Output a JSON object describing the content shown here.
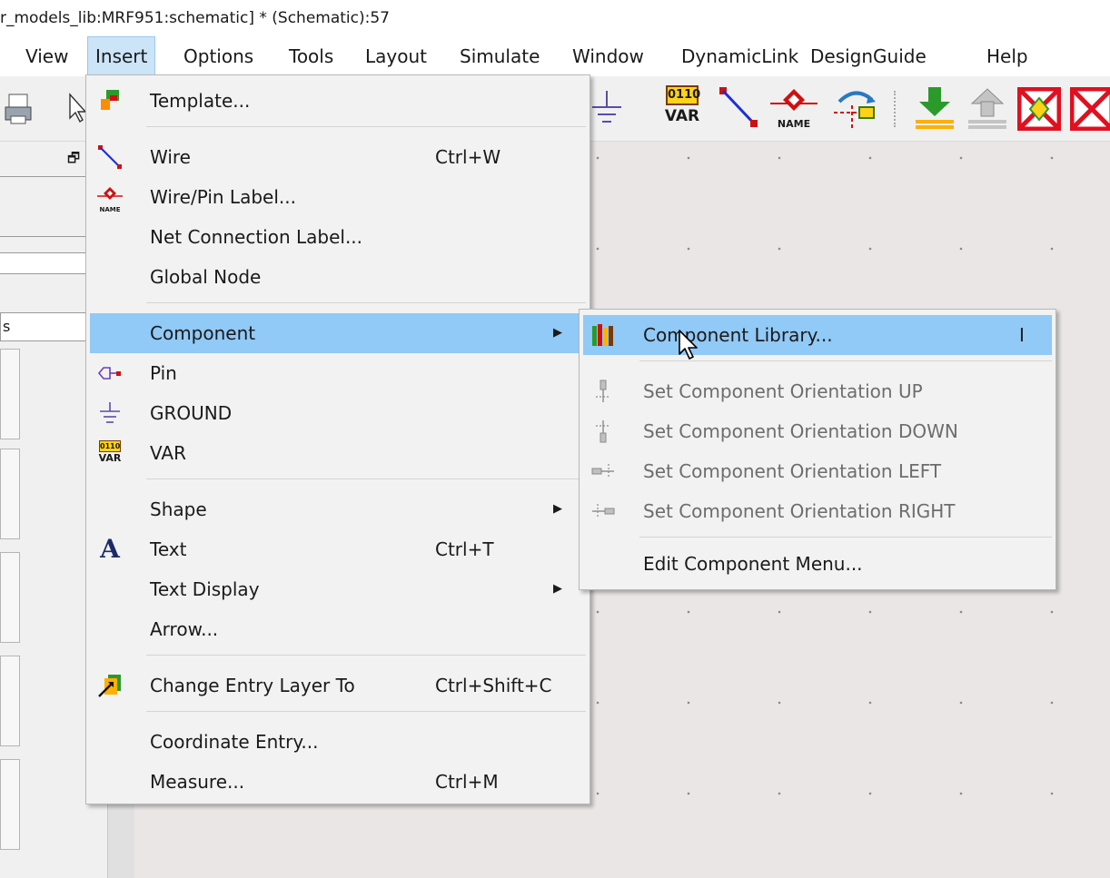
{
  "window": {
    "title": "r_models_lib:MRF951:schematic] * (Schematic):57"
  },
  "menubar": [
    {
      "label": "View"
    },
    {
      "label": "Insert"
    },
    {
      "label": "Options"
    },
    {
      "label": "Tools"
    },
    {
      "label": "Layout"
    },
    {
      "label": "Simulate"
    },
    {
      "label": "Window"
    },
    {
      "label": "DynamicLink"
    },
    {
      "label": "DesignGuide"
    },
    {
      "label": "Help"
    }
  ],
  "toolbar": {
    "var_icon_top": "0110",
    "var_icon_bottom": "VAR",
    "name_icon_text": "NAME"
  },
  "left_panel": {
    "partial_label": "s",
    "float_icon": "restore-window-icon"
  },
  "insert_menu": {
    "items": [
      {
        "label": "Template...",
        "icon": "template-icon"
      },
      {
        "label": "Wire",
        "shortcut": "Ctrl+W",
        "icon": "wire-icon"
      },
      {
        "label": "Wire/Pin Label...",
        "icon": "wire-label-icon",
        "icon_text": "NAME"
      },
      {
        "label": "Net Connection Label..."
      },
      {
        "label": "Global Node"
      },
      {
        "label": "Component",
        "submenu": true
      },
      {
        "label": "Pin",
        "icon": "pin-icon"
      },
      {
        "label": "GROUND",
        "icon": "ground-icon"
      },
      {
        "label": "VAR",
        "icon": "var-icon",
        "icon_text_top": "0110",
        "icon_text_bottom": "VAR"
      },
      {
        "label": "Shape",
        "submenu": true
      },
      {
        "label": "Text",
        "shortcut": "Ctrl+T",
        "icon": "text-icon",
        "icon_text": "A"
      },
      {
        "label": "Text Display",
        "submenu": true
      },
      {
        "label": "Arrow..."
      },
      {
        "label": "Change Entry Layer To",
        "shortcut": "Ctrl+Shift+C",
        "icon": "change-layer-icon"
      },
      {
        "label": "Coordinate Entry..."
      },
      {
        "label": "Measure...",
        "shortcut": "Ctrl+M"
      }
    ]
  },
  "component_submenu": {
    "items": [
      {
        "label": "Component Library...",
        "shortcut": "I",
        "icon": "library-books-icon"
      },
      {
        "label": "Set Component Orientation UP",
        "icon": "orient-up-icon",
        "disabled": true
      },
      {
        "label": "Set Component Orientation DOWN",
        "icon": "orient-down-icon",
        "disabled": true
      },
      {
        "label": "Set Component Orientation LEFT",
        "icon": "orient-left-icon",
        "disabled": true
      },
      {
        "label": "Set Component Orientation RIGHT",
        "icon": "orient-right-icon",
        "disabled": true
      },
      {
        "label": "Edit Component Menu..."
      }
    ]
  },
  "colors": {
    "menu_highlight": "#91c9f7",
    "menubar_active": "#cce4f7",
    "canvas_bg": "#eae6e6",
    "wire_color": "#1d2fd8"
  }
}
